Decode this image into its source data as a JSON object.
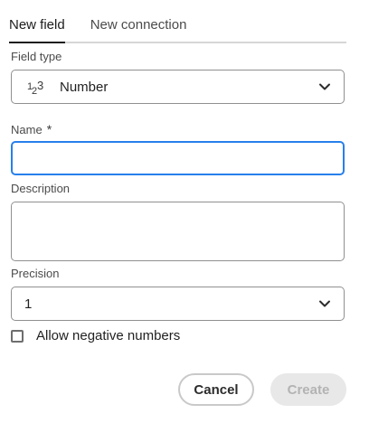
{
  "tabs": [
    {
      "label": "New field",
      "active": true
    },
    {
      "label": "New connection",
      "active": false
    }
  ],
  "field_type": {
    "label": "Field type",
    "value": "Number",
    "icon": "number-type-icon"
  },
  "name": {
    "label": "Name",
    "required_marker": "*",
    "value": "",
    "placeholder": ""
  },
  "description": {
    "label": "Description",
    "value": ""
  },
  "precision": {
    "label": "Precision",
    "value": "1"
  },
  "allow_negative": {
    "label": "Allow negative numbers",
    "checked": false
  },
  "actions": {
    "cancel_label": "Cancel",
    "create_label": "Create"
  },
  "colors": {
    "focus_accent": "#2680eb",
    "disabled_bg": "#e8e8e8",
    "disabled_text": "#b3b3b3"
  }
}
